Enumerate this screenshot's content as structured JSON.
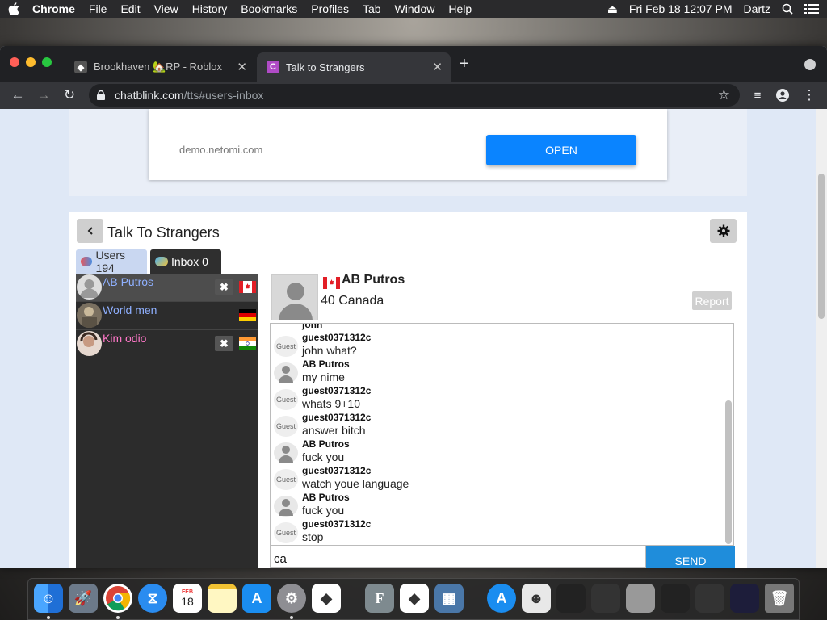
{
  "menubar": {
    "app": "Chrome",
    "items": [
      "File",
      "Edit",
      "View",
      "History",
      "Bookmarks",
      "Profiles",
      "Tab",
      "Window",
      "Help"
    ],
    "clock": "Fri Feb 18  12:07 PM",
    "user": "Dartz"
  },
  "browser": {
    "tabs": [
      {
        "title": "Brookhaven 🏡RP - Roblox"
      },
      {
        "title": "Talk to Strangers"
      }
    ],
    "url_domain": "chatblink.com",
    "url_path": "/tts#users-inbox"
  },
  "ad": {
    "domain": "demo.netomi.com",
    "button": "OPEN"
  },
  "chat": {
    "title": "Talk To Strangers",
    "tabs": {
      "users_label": "Users 194",
      "inbox_label": "Inbox 0"
    },
    "users": [
      {
        "name": "AB Putros",
        "color": "#8fb0ff",
        "flag": "canada"
      },
      {
        "name": "World men",
        "color": "#8fb0ff",
        "flag": "germany"
      },
      {
        "name": "Kim odio",
        "color": "#ff77c8",
        "flag": "india"
      }
    ],
    "profile": {
      "name": "AB Putros",
      "meta": "40 Canada",
      "report_label": "Report"
    },
    "messages": [
      {
        "who": "guest0371312c",
        "text": "john what?",
        "avatar": "Guest"
      },
      {
        "who": "AB Putros",
        "text": "my nime",
        "avatar": "person"
      },
      {
        "who": "guest0371312c",
        "text": "whats 9+10",
        "avatar": "Guest"
      },
      {
        "who": "guest0371312c",
        "text": "answer bitch",
        "avatar": "Guest"
      },
      {
        "who": "AB Putros",
        "text": "fuck you",
        "avatar": "person"
      },
      {
        "who": "guest0371312c",
        "text": "watch youe language",
        "avatar": "Guest"
      },
      {
        "who": "AB Putros",
        "text": "fuck you",
        "avatar": "person"
      },
      {
        "who": "guest0371312c",
        "text": "stop",
        "avatar": "Guest"
      }
    ],
    "partial_top_text": "john",
    "input_value": "ca",
    "send_label": "SEND"
  },
  "dock": {
    "calendar_month": "FEB",
    "calendar_day": "18"
  },
  "colors": {
    "accent": "#0a84ff",
    "send": "#1f8ddb",
    "inbox_tab": "#2f2f2f",
    "users_tab": "#c9d7f1"
  }
}
